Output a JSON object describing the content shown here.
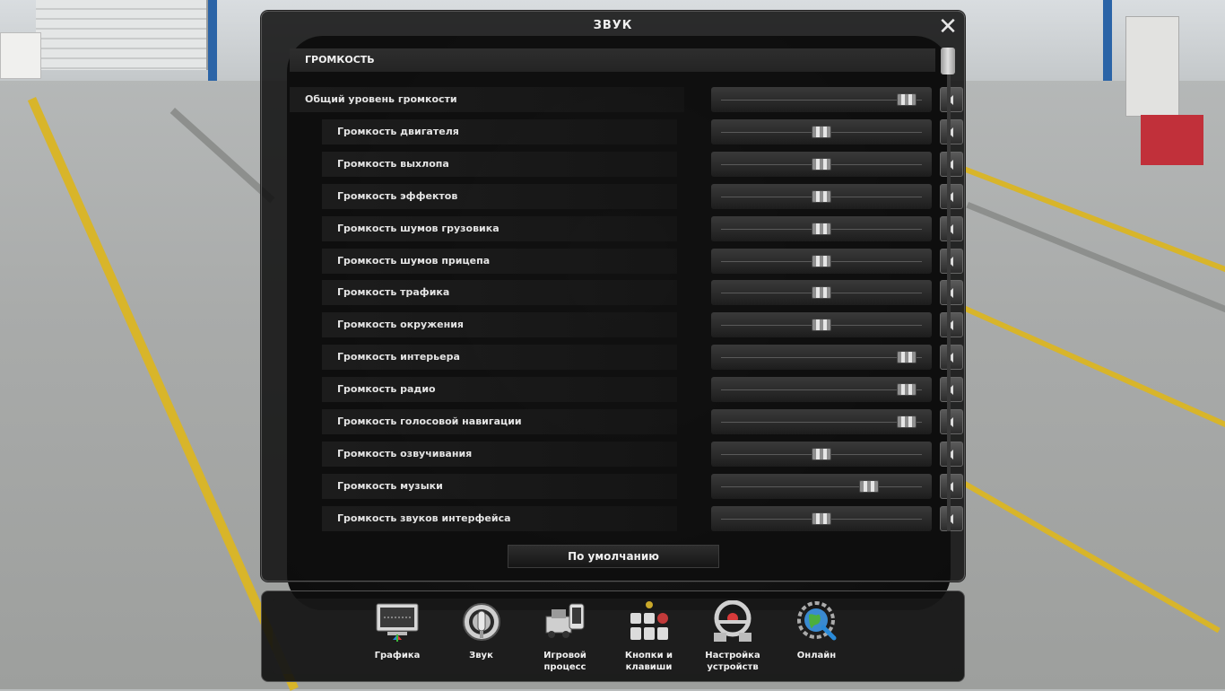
{
  "window": {
    "title": "ЗВУК",
    "close_label": "✕"
  },
  "section": {
    "title": "ГРОМКОСТЬ"
  },
  "volume_rows": [
    {
      "label": "Общий уровень громкости",
      "level": 0.95,
      "master": true
    },
    {
      "label": "Громкость двигателя",
      "level": 0.5
    },
    {
      "label": "Громкость выхлопа",
      "level": 0.5
    },
    {
      "label": "Громкость эффектов",
      "level": 0.5
    },
    {
      "label": "Громкость шумов грузовика",
      "level": 0.5
    },
    {
      "label": "Громкость шумов прицепа",
      "level": 0.5
    },
    {
      "label": "Громкость трафика",
      "level": 0.5
    },
    {
      "label": "Громкость окружения",
      "level": 0.5
    },
    {
      "label": "Громкость интерьера",
      "level": 0.95
    },
    {
      "label": "Громкость радио",
      "level": 0.95
    },
    {
      "label": "Громкость голосовой навигации",
      "level": 0.95
    },
    {
      "label": "Громкость озвучивания",
      "level": 0.5
    },
    {
      "label": "Громкость музыки",
      "level": 0.75
    },
    {
      "label": "Громкость звуков интерфейса",
      "level": 0.5
    }
  ],
  "default_button": {
    "label": "По умолчанию"
  },
  "bottom_nav": [
    {
      "id": "graphics",
      "label": "Графика",
      "icon": "monitor-icon"
    },
    {
      "id": "sound",
      "label": "Звук",
      "icon": "speaker-icon",
      "active": true
    },
    {
      "id": "gameplay",
      "label": "Игровой\nпроцесс",
      "icon": "truck-icon"
    },
    {
      "id": "controls",
      "label": "Кнопки и\nклавиши",
      "icon": "keys-icon"
    },
    {
      "id": "devices",
      "label": "Настройка\nустройств",
      "icon": "steering-wheel-icon"
    },
    {
      "id": "online",
      "label": "Онлайн",
      "icon": "globe-icon"
    }
  ],
  "colors": {
    "panel_bg": "#0e0e0e",
    "text": "#e8e8e8",
    "accent": "#d8b52a"
  }
}
